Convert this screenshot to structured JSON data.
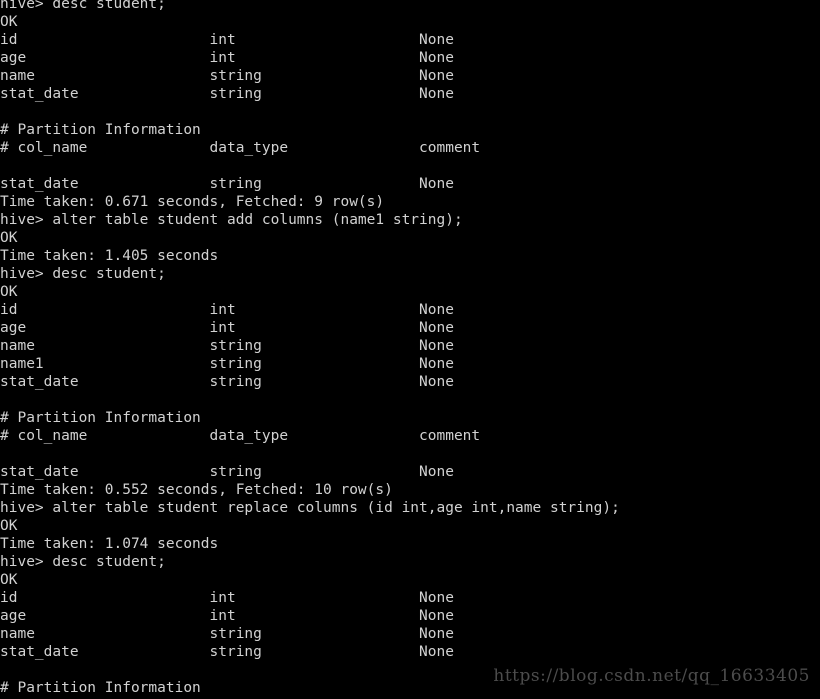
{
  "terminal": {
    "background_color": "#000000",
    "text_color": "#d2d2d2",
    "prompt": "hive>",
    "column_positions": [
      0,
      24,
      48
    ],
    "lines": [
      "hive> desc student;",
      "OK",
      "id                      int                     None",
      "age                     int                     None",
      "name                    string                  None",
      "stat_date               string                  None",
      "",
      "# Partition Information",
      "# col_name              data_type               comment",
      "",
      "stat_date               string                  None",
      "Time taken: 0.671 seconds, Fetched: 9 row(s)",
      "hive> alter table student add columns (name1 string);",
      "OK",
      "Time taken: 1.405 seconds",
      "hive> desc student;",
      "OK",
      "id                      int                     None",
      "age                     int                     None",
      "name                    string                  None",
      "name1                   string                  None",
      "stat_date               string                  None",
      "",
      "# Partition Information",
      "# col_name              data_type               comment",
      "",
      "stat_date               string                  None",
      "Time taken: 0.552 seconds, Fetched: 10 row(s)",
      "hive> alter table student replace columns (id int,age int,name string);",
      "OK",
      "Time taken: 1.074 seconds",
      "hive> desc student;",
      "OK",
      "id                      int                     None",
      "age                     int                     None",
      "name                    string                  None",
      "stat_date               string                  None",
      "",
      "# Partition Information"
    ],
    "commands": [
      "desc student;",
      "alter table student add columns (name1 string);",
      "desc student;",
      "alter table student replace columns (id int,age int,name string);",
      "desc student;"
    ],
    "status_lines": [
      "OK",
      "Time taken: 0.671 seconds, Fetched: 9 row(s)",
      "Time taken: 1.405 seconds",
      "Time taken: 0.552 seconds, Fetched: 10 row(s)",
      "Time taken: 1.074 seconds"
    ],
    "schema_headers": [
      "# col_name",
      "data_type",
      "comment"
    ],
    "partition_section_title": "# Partition Information",
    "describe_outputs": [
      {
        "columns": [
          {
            "col_name": "id",
            "data_type": "int",
            "comment": "None"
          },
          {
            "col_name": "age",
            "data_type": "int",
            "comment": "None"
          },
          {
            "col_name": "name",
            "data_type": "string",
            "comment": "None"
          },
          {
            "col_name": "stat_date",
            "data_type": "string",
            "comment": "None"
          }
        ],
        "partition_columns": [
          {
            "col_name": "stat_date",
            "data_type": "string",
            "comment": "None"
          }
        ],
        "fetched_rows": "9"
      },
      {
        "columns": [
          {
            "col_name": "id",
            "data_type": "int",
            "comment": "None"
          },
          {
            "col_name": "age",
            "data_type": "int",
            "comment": "None"
          },
          {
            "col_name": "name",
            "data_type": "string",
            "comment": "None"
          },
          {
            "col_name": "name1",
            "data_type": "string",
            "comment": "None"
          },
          {
            "col_name": "stat_date",
            "data_type": "string",
            "comment": "None"
          }
        ],
        "partition_columns": [
          {
            "col_name": "stat_date",
            "data_type": "string",
            "comment": "None"
          }
        ],
        "fetched_rows": "10"
      },
      {
        "columns": [
          {
            "col_name": "id",
            "data_type": "int",
            "comment": "None"
          },
          {
            "col_name": "age",
            "data_type": "int",
            "comment": "None"
          },
          {
            "col_name": "name",
            "data_type": "string",
            "comment": "None"
          },
          {
            "col_name": "stat_date",
            "data_type": "string",
            "comment": "None"
          }
        ],
        "partition_columns": [],
        "fetched_rows": ""
      }
    ]
  },
  "watermark": {
    "text": "https://blog.csdn.net/qq_16633405",
    "color": "#4c4c4c"
  }
}
